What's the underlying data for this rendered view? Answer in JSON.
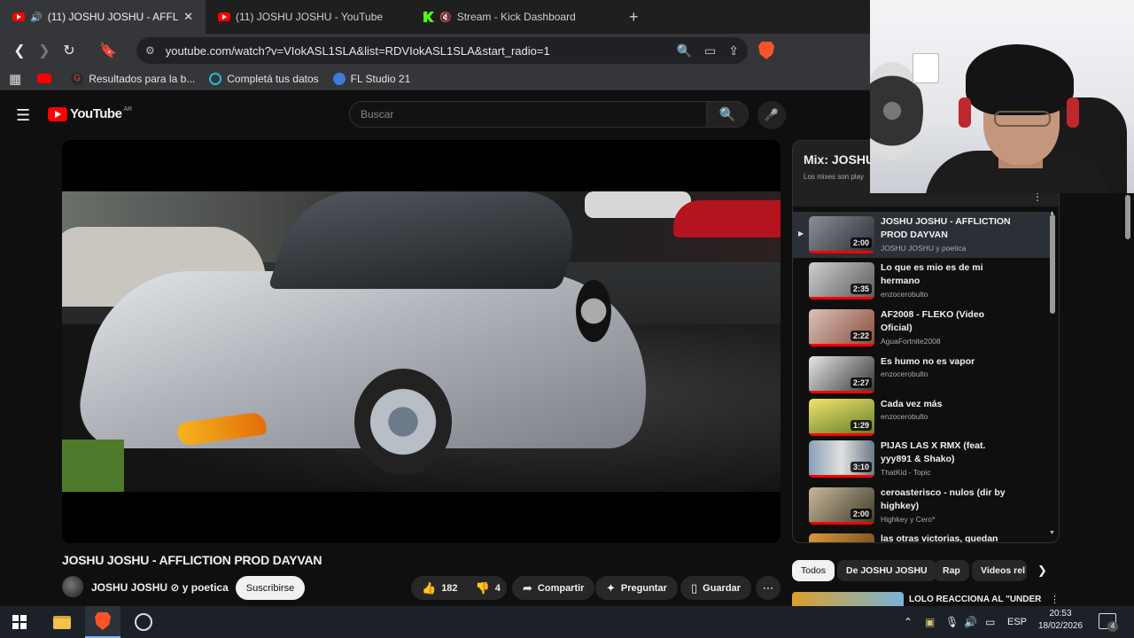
{
  "browser": {
    "tabs": [
      {
        "title": "(11) JOSHU JOSHU - AFFLICTI",
        "active": true,
        "icon": "youtube-icon",
        "audio": true
      },
      {
        "title": "(11) JOSHU JOSHU - YouTube",
        "active": false,
        "icon": "youtube-icon"
      },
      {
        "title": "Stream - Kick Dashboard",
        "active": false,
        "icon": "kick-icon",
        "muted": true
      }
    ],
    "new_tab": "+",
    "url": "youtube.com/watch?v=VIokASL1SLA&list=RDVIokASL1SLA&start_radio=1",
    "bookmarks": [
      {
        "label": "Resultados para la b...",
        "icon": "google-icon"
      },
      {
        "label": "Completá tus datos",
        "icon": "circle-icon"
      },
      {
        "label": "FL Studio 21",
        "icon": "fl-studio-icon"
      }
    ]
  },
  "youtube": {
    "logo_text": "YouTube",
    "country": "AR",
    "search_placeholder": "Buscar",
    "video": {
      "title": "JOSHU JOSHU - AFFLICTION PROD DAYVAN",
      "channel": "JOSHU JOSHU ⊘ y poetica",
      "subscribe": "Suscribirse",
      "likes": "182",
      "dislikes": "4",
      "share": "Compartir",
      "ask": "Preguntar",
      "save": "Guardar"
    },
    "playlist": {
      "title": "Mix: JOSHU",
      "subtitle": "Los mixes son play",
      "items": [
        {
          "title": "JOSHU JOSHU - AFFLICTION PROD DAYVAN",
          "channel": "JOSHU JOSHU y poetica",
          "duration": "2:00",
          "current": true
        },
        {
          "title": "Lo que es mio es de mi hermano",
          "channel": "enzocerobulto",
          "duration": "2:35"
        },
        {
          "title": "AF2008 - FLEKO (Video Oficial)",
          "channel": "AguaFortnite2008",
          "duration": "2:22"
        },
        {
          "title": "Es humo no es vapor",
          "channel": "enzocerobulto",
          "duration": "2:27"
        },
        {
          "title": "Cada vez más",
          "channel": "enzocerobulto",
          "duration": "1:29"
        },
        {
          "title": "PIJAS LAS X RMX (feat. yyy891 & Shako)",
          "channel": "ThatKid - Topic",
          "duration": "3:10"
        },
        {
          "title": "ceroasterisco - nulos (dir by highkey)",
          "channel": "Highkey y Cero*",
          "duration": "2:00"
        },
        {
          "title": "las otras victorias, quedan",
          "channel": "",
          "duration": ""
        }
      ]
    },
    "chips": [
      "Todos",
      "De JOSHU JOSHU",
      "Rap",
      "Videos rel"
    ],
    "recommended_title": "LOLO REACCIONA AL \"UNDER"
  },
  "taskbar": {
    "language": "ESP",
    "time": "20:53",
    "date": "18/02/2026",
    "notifications": "4"
  },
  "colors": {
    "youtube_red": "#ff0000",
    "brave_orange": "#fb542b",
    "kick_green": "#53fc18"
  }
}
